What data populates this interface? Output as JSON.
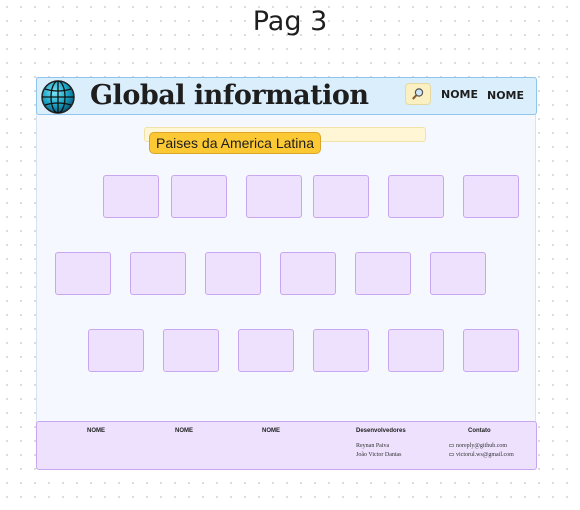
{
  "page_label": "Pag 3",
  "header": {
    "logo_icon": "globe-icon",
    "title": "Global information",
    "search_icon": "magnifier-icon",
    "nav": [
      "NOME",
      "NOME"
    ]
  },
  "section": {
    "title": "Paises da America Latina"
  },
  "cards": {
    "row1_count": 6,
    "row2_count": 6,
    "row3_count": 6
  },
  "footer": {
    "columns": [
      "NOME",
      "NOME",
      "NOME"
    ],
    "developers": {
      "heading": "Desenvolvedores",
      "names": [
        "Reynan Paiva",
        "João Victor Dantas"
      ]
    },
    "contact": {
      "heading": "Contato",
      "emails": [
        "noreply@github.com",
        "victorul.ws@gmail.com"
      ]
    }
  },
  "colors": {
    "header_bg": "#dbeefc",
    "card_bg": "#ede1fd",
    "card_border": "#c9a6f0",
    "badge": "#fcc934"
  }
}
